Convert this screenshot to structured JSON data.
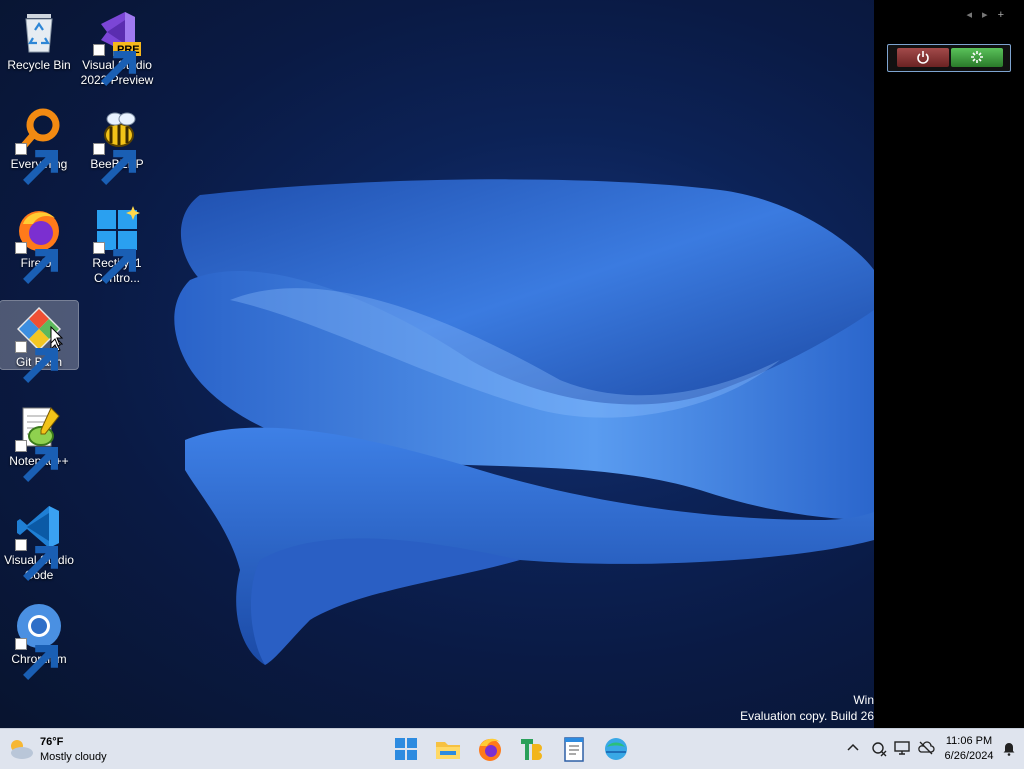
{
  "desktop_icons": [
    {
      "label": "Recycle Bin",
      "icon": "recycle-bin-icon"
    },
    {
      "label": "Visual Studio\n2022 Preview",
      "icon": "visual-studio-preview-icon",
      "badge": "PRE"
    },
    {
      "label": "Everything",
      "icon": "everything-search-icon"
    },
    {
      "label": "BeeBEEP",
      "icon": "beebeep-icon"
    },
    {
      "label": "Firefox",
      "icon": "firefox-icon"
    },
    {
      "label": "Rectify11\nContro...",
      "icon": "rectify11-icon"
    },
    {
      "label": "Git Bash",
      "icon": "git-bash-icon"
    },
    {
      "label": "Notepad++",
      "icon": "notepadpp-icon"
    },
    {
      "label": "Visual Studio\nCode",
      "icon": "vscode-icon"
    },
    {
      "label": "Chromium",
      "icon": "chromium-icon"
    }
  ],
  "watermark": {
    "line1": "Win",
    "line2": "Evaluation copy. Build 26"
  },
  "taskbar": {
    "weather": {
      "temp": "76°F",
      "condition": "Mostly cloudy",
      "icon": "partly-cloudy-icon"
    },
    "apps": [
      "start-icon",
      "file-explorer-icon",
      "firefox-icon",
      "terabox-icon",
      "notepad-icon",
      "edge-globe-icon"
    ],
    "tray_icons": [
      "chevron-up-icon",
      "network-off-icon",
      "display-icon",
      "cloud-off-icon",
      "bell-icon"
    ],
    "clock": {
      "time": "11:06 PM",
      "date": "6/26/2024"
    }
  },
  "sidebar": {
    "nav": [
      "◂",
      "▸",
      "+"
    ],
    "gadget": {
      "buttons": [
        "power-icon",
        "restart-icon"
      ]
    }
  },
  "colors": {
    "wallpaper_dark": "#0a1a44",
    "bloom_blue": "#3a78d8",
    "taskbar_bg": "#dfe4ee",
    "sidebar_bg": "#000000"
  }
}
